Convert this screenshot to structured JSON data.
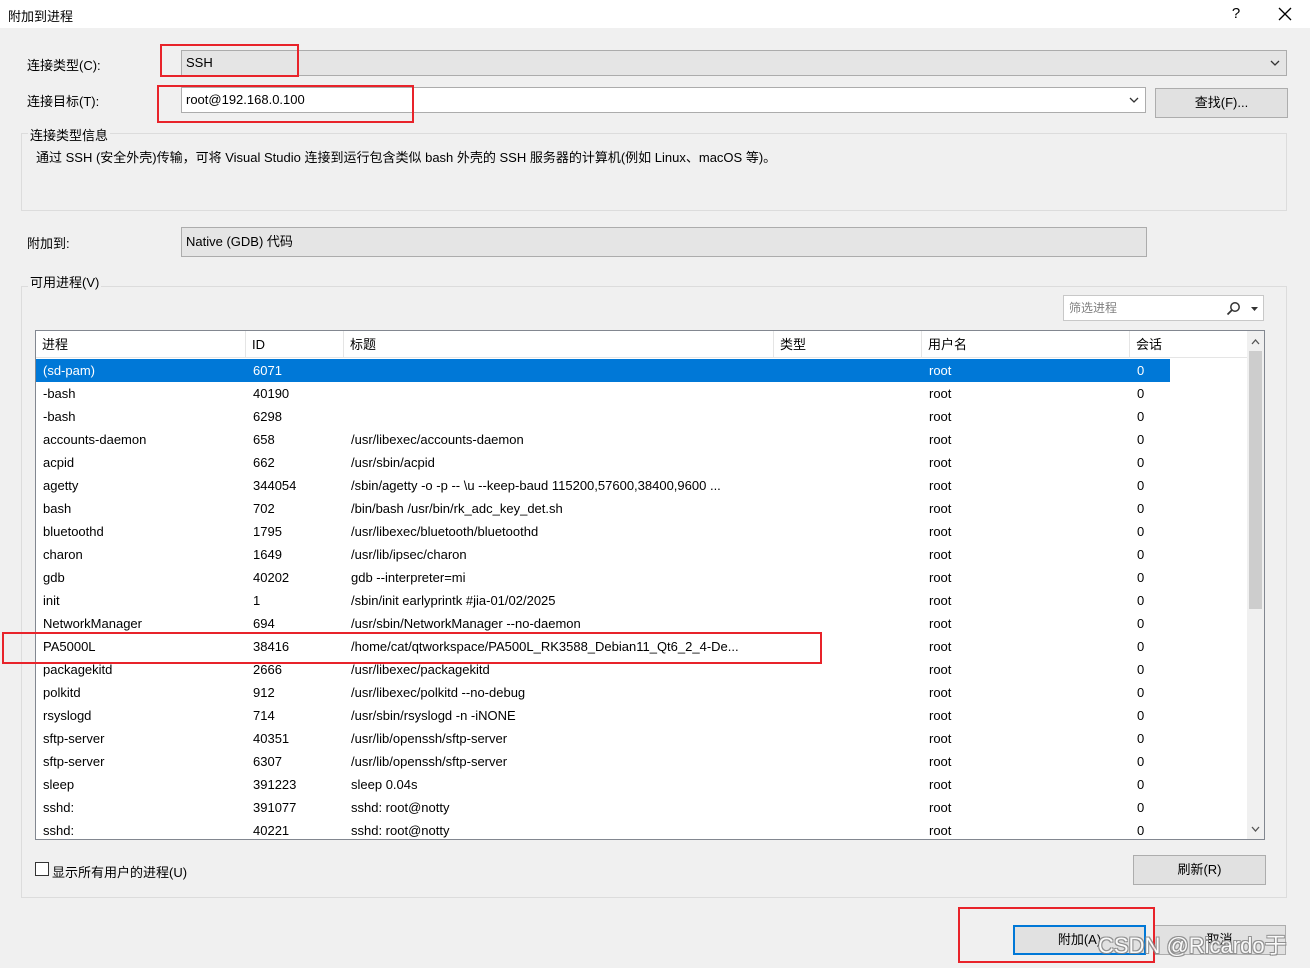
{
  "window": {
    "title": "附加到进程",
    "help_label": "?"
  },
  "connection": {
    "type_label": "连接类型(C):",
    "type_value": "SSH",
    "target_label": "连接目标(T):",
    "target_value": "root@192.168.0.100",
    "find_button": "查找(F)...",
    "info_group_title": "连接类型信息",
    "info_text": "通过 SSH (安全外壳)传输，可将 Visual Studio 连接到运行包含类似 bash 外壳的 SSH 服务器的计算机(例如 Linux、macOS 等)。"
  },
  "attach_to": {
    "label": "附加到:",
    "value": "Native (GDB) 代码"
  },
  "processes": {
    "group_title": "可用进程(V)",
    "filter_placeholder": "筛选进程",
    "columns": [
      "进程",
      "ID",
      "标题",
      "类型",
      "用户名",
      "会话"
    ],
    "rows": [
      {
        "name": "(sd-pam)",
        "id": "6071",
        "title": "",
        "type": "",
        "user": "root",
        "session": "0",
        "selected": true
      },
      {
        "name": "-bash",
        "id": "40190",
        "title": "",
        "type": "",
        "user": "root",
        "session": "0"
      },
      {
        "name": "-bash",
        "id": "6298",
        "title": "",
        "type": "",
        "user": "root",
        "session": "0"
      },
      {
        "name": "accounts-daemon",
        "id": "658",
        "title": "/usr/libexec/accounts-daemon",
        "type": "",
        "user": "root",
        "session": "0"
      },
      {
        "name": "acpid",
        "id": "662",
        "title": "/usr/sbin/acpid",
        "type": "",
        "user": "root",
        "session": "0"
      },
      {
        "name": "agetty",
        "id": "344054",
        "title": "/sbin/agetty -o -p -- \\u --keep-baud 115200,57600,38400,9600 ...",
        "type": "",
        "user": "root",
        "session": "0"
      },
      {
        "name": "bash",
        "id": "702",
        "title": "/bin/bash /usr/bin/rk_adc_key_det.sh",
        "type": "",
        "user": "root",
        "session": "0"
      },
      {
        "name": "bluetoothd",
        "id": "1795",
        "title": "/usr/libexec/bluetooth/bluetoothd",
        "type": "",
        "user": "root",
        "session": "0"
      },
      {
        "name": "charon",
        "id": "1649",
        "title": "/usr/lib/ipsec/charon",
        "type": "",
        "user": "root",
        "session": "0"
      },
      {
        "name": "gdb",
        "id": "40202",
        "title": "gdb --interpreter=mi",
        "type": "",
        "user": "root",
        "session": "0"
      },
      {
        "name": "init",
        "id": "1",
        "title": "/sbin/init earlyprintk #jia-01/02/2025",
        "type": "",
        "user": "root",
        "session": "0"
      },
      {
        "name": "NetworkManager",
        "id": "694",
        "title": "/usr/sbin/NetworkManager --no-daemon",
        "type": "",
        "user": "root",
        "session": "0"
      },
      {
        "name": "PA5000L",
        "id": "38416",
        "title": "/home/cat/qtworkspace/PA500L_RK3588_Debian11_Qt6_2_4-De...",
        "type": "",
        "user": "root",
        "session": "0"
      },
      {
        "name": "packagekitd",
        "id": "2666",
        "title": "/usr/libexec/packagekitd",
        "type": "",
        "user": "root",
        "session": "0"
      },
      {
        "name": "polkitd",
        "id": "912",
        "title": "/usr/libexec/polkitd --no-debug",
        "type": "",
        "user": "root",
        "session": "0"
      },
      {
        "name": "rsyslogd",
        "id": "714",
        "title": "/usr/sbin/rsyslogd -n -iNONE",
        "type": "",
        "user": "root",
        "session": "0"
      },
      {
        "name": "sftp-server",
        "id": "40351",
        "title": "/usr/lib/openssh/sftp-server",
        "type": "",
        "user": "root",
        "session": "0"
      },
      {
        "name": "sftp-server",
        "id": "6307",
        "title": "/usr/lib/openssh/sftp-server",
        "type": "",
        "user": "root",
        "session": "0"
      },
      {
        "name": "sleep",
        "id": "391223",
        "title": "sleep 0.04s",
        "type": "",
        "user": "root",
        "session": "0"
      },
      {
        "name": "sshd:",
        "id": "391077",
        "title": "sshd: root@notty",
        "type": "",
        "user": "root",
        "session": "0"
      },
      {
        "name": "sshd:",
        "id": "40221",
        "title": "sshd: root@notty",
        "type": "",
        "user": "root",
        "session": "0"
      }
    ],
    "show_all_users_label": "显示所有用户的进程(U)",
    "refresh_button": "刷新(R)"
  },
  "footer": {
    "attach_button": "附加(A)",
    "cancel_button": "取消"
  },
  "watermark": "CSDN @Ricardo于",
  "colors": {
    "selection": "#0078d7",
    "highlight_box": "#e8232a",
    "dialog_bg": "#f0f0f0"
  }
}
